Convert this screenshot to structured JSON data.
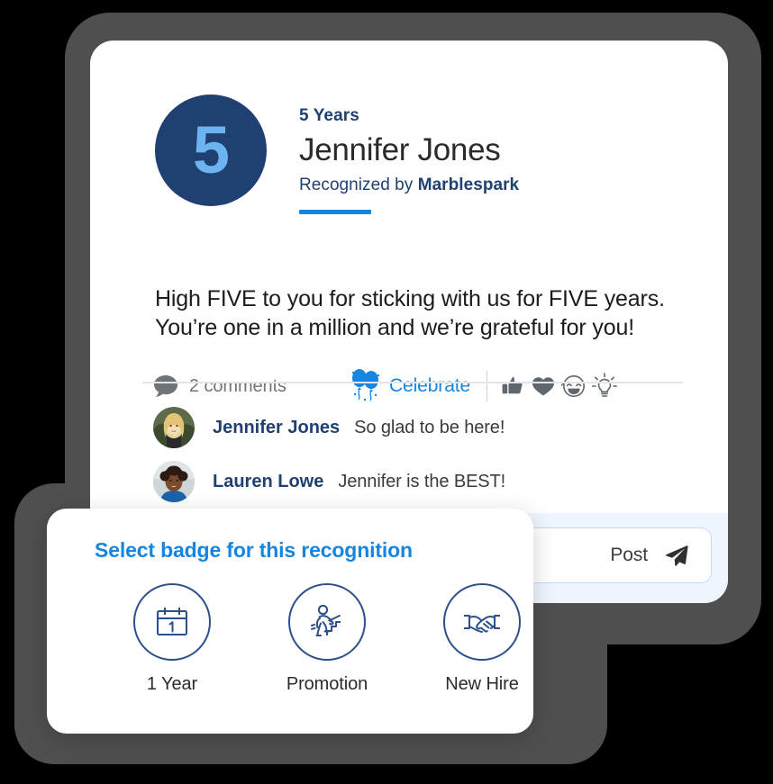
{
  "theme": {
    "page_background": "#000000",
    "device_frame": "#4f4f4f",
    "card_background": "#ffffff",
    "navy": "#1f4070",
    "badge_number_blue": "#6cb3ef",
    "accent_blue": "#1585e0",
    "composer_strip": "#eef5fd",
    "muted_text": "#6f7478",
    "badge_outline": "#2d4f8c"
  },
  "recognition": {
    "milestone_label": "5 Years",
    "badge_number": "5",
    "recipient_name": "Jennifer Jones",
    "recognized_by_prefix": "Recognized by",
    "recognized_by_company": "Marblespark",
    "message": "High FIVE to you for sticking with us for FIVE years. You’re one in a million and we’re grateful for you!"
  },
  "actions": {
    "comments_count_label": "2 comments",
    "comment_icon": "speech-bubble-icon",
    "celebrate_label": "Celebrate",
    "celebrate_icon": "balloons-icon",
    "reactions": [
      {
        "name": "thumbs-up-icon",
        "label": "Like"
      },
      {
        "name": "heart-icon",
        "label": "Love"
      },
      {
        "name": "laughing-face-icon",
        "label": "Laugh"
      },
      {
        "name": "lightbulb-icon",
        "label": "Insightful"
      }
    ]
  },
  "comments": [
    {
      "author": "Jennifer Jones",
      "text": "So glad to be here!",
      "avatar": "avatar-jennifer-jones"
    },
    {
      "author": "Lauren Lowe",
      "text": "Jennifer is the BEST!",
      "avatar": "avatar-lauren-lowe"
    }
  ],
  "composer": {
    "post_label": "Post",
    "send_icon": "paper-plane-icon",
    "placeholder": ""
  },
  "badge_picker": {
    "title": "Select badge for this recognition",
    "options": [
      {
        "label": "1 Year",
        "icon": "calendar-one-icon"
      },
      {
        "label": "Promotion",
        "icon": "person-climbing-stairs-icon"
      },
      {
        "label": "New Hire",
        "icon": "handshake-icon"
      }
    ]
  }
}
